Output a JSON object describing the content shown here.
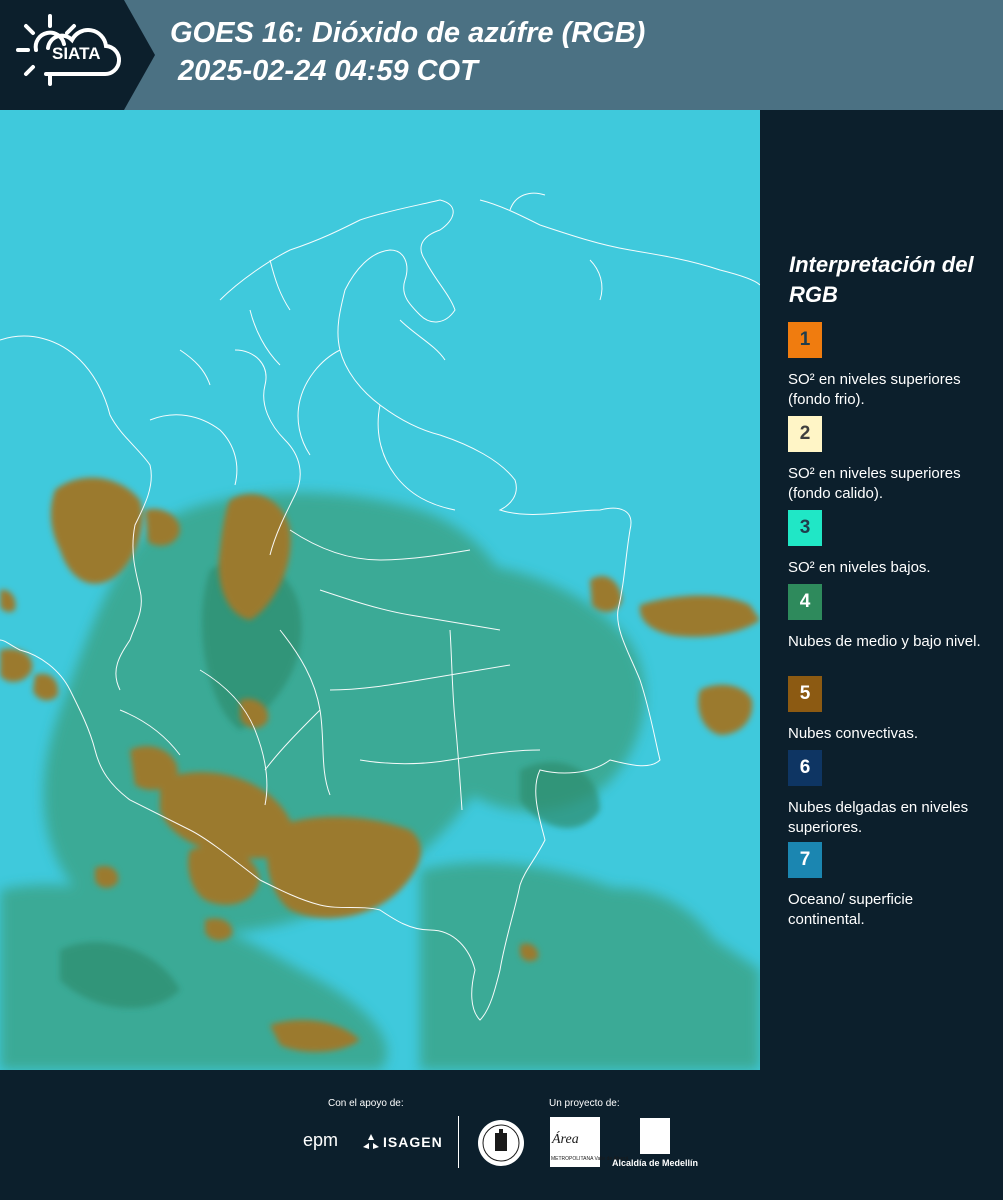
{
  "header": {
    "logo_text": "SIATA",
    "title_line1": "GOES 16: Dióxido de azúfre (RGB)",
    "title_line2": "2025-02-24 04:59 COT"
  },
  "legend": {
    "title": "Interpretación del RGB",
    "items": [
      {
        "num": "1",
        "color": "#f07c0f",
        "num_color": "#1f3d4c",
        "text": "SO² en niveles superiores (fondo frio)."
      },
      {
        "num": "2",
        "color": "#fff5c6",
        "num_color": "#3f3f3f",
        "text": "SO² en niveles superiores (fondo calido)."
      },
      {
        "num": "3",
        "color": "#20e7c6",
        "num_color": "#1f3d4c",
        "text": "SO² en niveles bajos."
      },
      {
        "num": "4",
        "color": "#2e8a5c",
        "num_color": "#ffffff",
        "text": "Nubes de medio y bajo nivel."
      },
      {
        "num": "5",
        "color": "#8c5a12",
        "num_color": "#ffffff",
        "text": "Nubes convectivas."
      },
      {
        "num": "6",
        "color": "#0e3563",
        "num_color": "#ffffff",
        "text": "Nubes delgadas en niveles superiores."
      },
      {
        "num": "7",
        "color": "#1b86b1",
        "num_color": "#ffffff",
        "text": "Oceano/ superficie continental."
      }
    ]
  },
  "footer": {
    "support_label": "Con el apoyo de:",
    "project_label": "Un proyecto de:",
    "epm": "epm",
    "isagen": "ISAGEN",
    "area_logo_text": "Área",
    "area_subtext": "METROPOLITANA Valle de Aburrá",
    "alcaldia": "Alcaldía de Medellín"
  },
  "map": {
    "colors": {
      "background_cyan": "#3fc9dc",
      "green_land": "#3aa58a",
      "dark_green": "#2d8d6e",
      "convective": "#9b7a2e",
      "border_lines": "#ffffff"
    }
  }
}
